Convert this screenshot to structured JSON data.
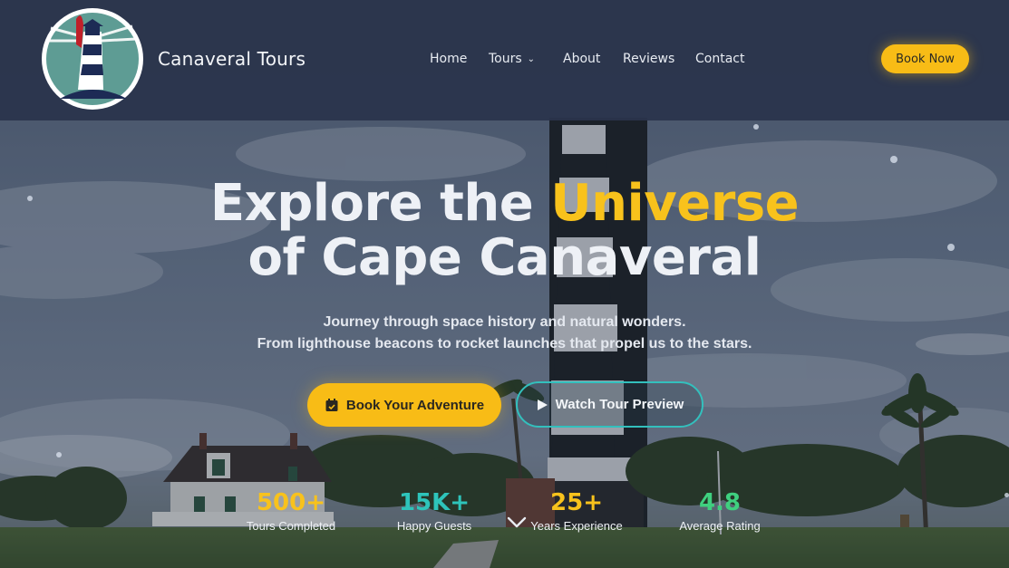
{
  "brand": {
    "name": "Canaveral Tours",
    "logo_icon": "lighthouse-rocket-logo"
  },
  "nav": {
    "items": [
      {
        "label": "Home"
      },
      {
        "label": "Tours",
        "has_dropdown": true
      },
      {
        "label": "About"
      },
      {
        "label": "Reviews"
      },
      {
        "label": "Contact"
      }
    ],
    "cta_label": "Book Now"
  },
  "hero": {
    "title_part1": "Explore the ",
    "title_accent": "Universe",
    "title_line2": "of Cape Canaveral",
    "subtitle_line1": "Journey through space history and natural wonders.",
    "subtitle_line2": "From lighthouse beacons to rocket launches that propel us to the stars.",
    "primary_button": {
      "label": "Book Your Adventure",
      "icon": "calendar-icon"
    },
    "secondary_button": {
      "label": "Watch Tour Preview",
      "icon": "play-icon"
    }
  },
  "stats": [
    {
      "value": "500+",
      "label": "Tours Completed",
      "color": "#f8c21c"
    },
    {
      "value": "15K+",
      "label": "Happy Guests",
      "color": "#2ec4bb"
    },
    {
      "value": "25+",
      "label": "Years Experience",
      "color": "#f8c21c"
    },
    {
      "value": "4.8",
      "label": "Average Rating",
      "color": "#3fd07f"
    }
  ],
  "colors": {
    "accent": "#f8bc16",
    "teal": "#33c0bd",
    "header_bg": "#2a344b"
  }
}
